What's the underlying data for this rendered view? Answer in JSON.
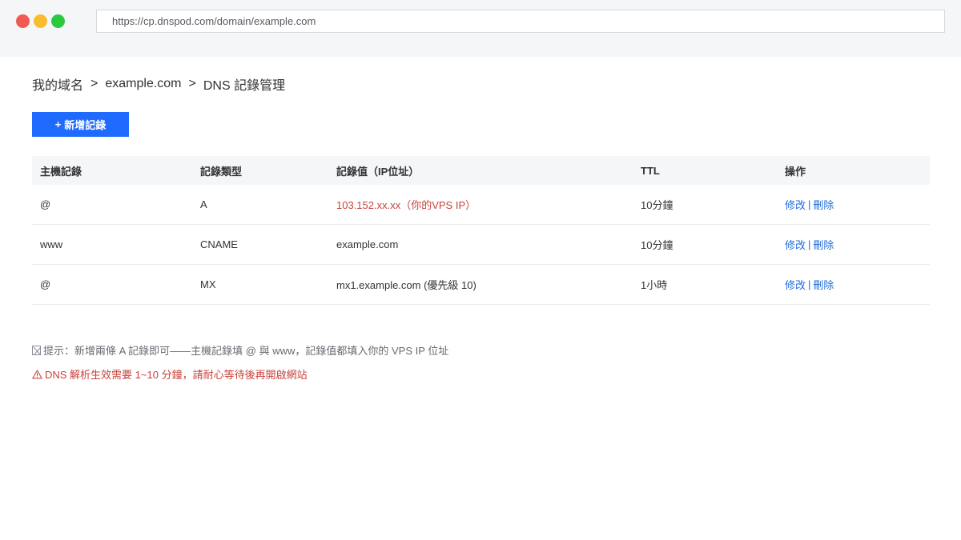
{
  "browser": {
    "url": "https://cp.dnspod.com/domain/example.com"
  },
  "breadcrumb": {
    "items": [
      "我的域名",
      "example.com",
      "DNS 記錄管理"
    ],
    "separator": ">"
  },
  "toolbar": {
    "add_plus": "+",
    "add_label": "新增記錄"
  },
  "table": {
    "headers": [
      "主機記錄",
      "記錄類型",
      "記錄值（IP位址）",
      "TTL",
      "操作"
    ],
    "rows": [
      {
        "host": "@",
        "type": "A",
        "value": "103.152.xx.xx（你的VPS IP）",
        "ttl": "10分鐘",
        "edit": "修改",
        "delete": "刪除"
      },
      {
        "host": "www",
        "type": "CNAME",
        "value": "example.com",
        "ttl": "10分鐘",
        "edit": "修改",
        "delete": "刪除"
      },
      {
        "host": "@",
        "type": "MX",
        "value": "mx1.example.com (優先級 10)",
        "ttl": "1小時",
        "edit": "修改",
        "delete": "刪除"
      }
    ],
    "action_separator": "|"
  },
  "notes": {
    "tip": "提示：新增兩條 A 記錄即可——主機記錄填 @ 與 www，記錄值都填入你的 VPS IP 位址",
    "warning": "DNS 解析生效需要 1~10 分鐘，請耐心等待後再開啟網站"
  },
  "colors": {
    "primary": "#1f6bff",
    "link": "#1f6bd8",
    "highlight_red": "#c8413b",
    "header_bg": "#f5f6f8"
  },
  "icons": {
    "tip": "tip-box-icon",
    "warning": "warning-triangle-icon"
  }
}
